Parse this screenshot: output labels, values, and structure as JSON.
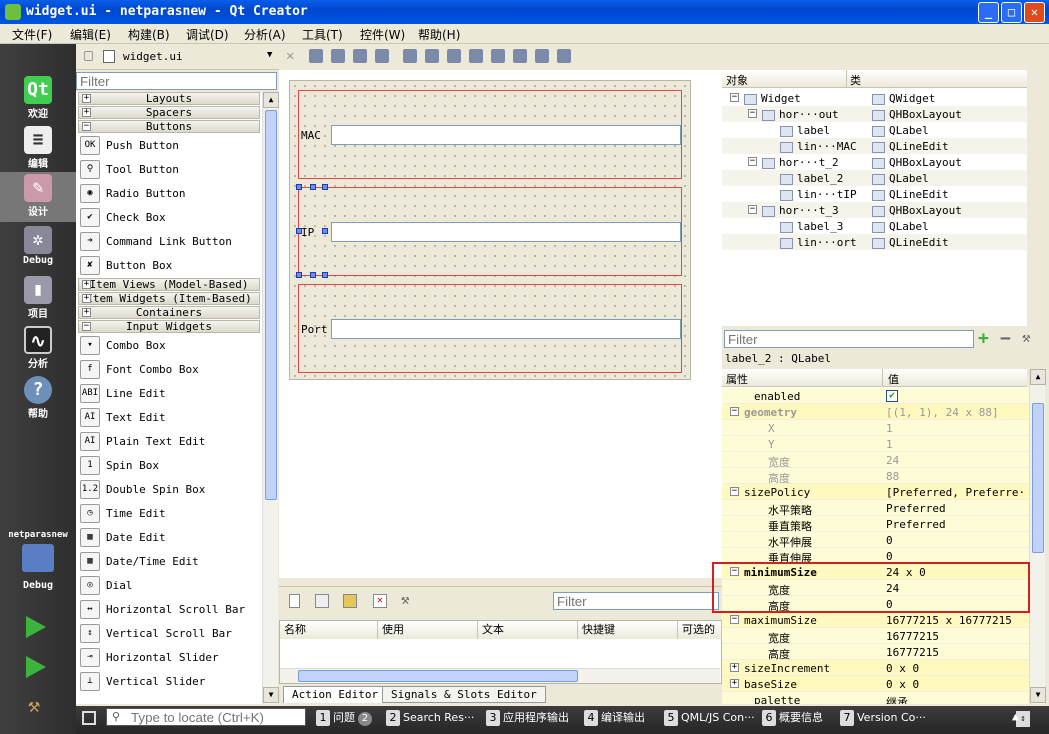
{
  "window": {
    "title": "widget.ui - netparasnew - Qt Creator"
  },
  "menu": [
    "文件(F)",
    "编辑(E)",
    "构建(B)",
    "调试(D)",
    "分析(A)",
    "工具(T)",
    "控件(W)",
    "帮助(H)"
  ],
  "modes": [
    {
      "label": "欢迎",
      "icon": "qt-logo-icon"
    },
    {
      "label": "编辑",
      "icon": "document-icon"
    },
    {
      "label": "设计",
      "icon": "design-pen-icon"
    },
    {
      "label": "Debug",
      "icon": "debug-bug-icon"
    },
    {
      "label": "项目",
      "icon": "project-wrench-icon"
    },
    {
      "label": "分析",
      "icon": "analyze-monitor-icon"
    },
    {
      "label": "帮助",
      "icon": "help-question-icon"
    }
  ],
  "kit": {
    "project": "netparasnew",
    "config": "Debug"
  },
  "doc": {
    "filename": "widget.ui"
  },
  "widget_box": {
    "filter_placeholder": "Filter",
    "items": [
      {
        "kind": "cat",
        "label": "Layouts",
        "sign": "+"
      },
      {
        "kind": "cat",
        "label": "Spacers",
        "sign": "+"
      },
      {
        "kind": "cat",
        "label": "Buttons",
        "sign": "−"
      },
      {
        "kind": "w",
        "label": "Push Button",
        "icon": "OK"
      },
      {
        "kind": "w",
        "label": "Tool Button",
        "icon": "⚲"
      },
      {
        "kind": "w",
        "label": "Radio Button",
        "icon": "◉"
      },
      {
        "kind": "w",
        "label": "Check Box",
        "icon": "✔"
      },
      {
        "kind": "w",
        "label": "Command Link Button",
        "icon": "➜"
      },
      {
        "kind": "w",
        "label": "Button Box",
        "icon": "✘"
      },
      {
        "kind": "cat",
        "label": "Item Views (Model-Based)",
        "sign": "+"
      },
      {
        "kind": "cat",
        "label": "Item Widgets (Item-Based)",
        "sign": "+"
      },
      {
        "kind": "cat",
        "label": "Containers",
        "sign": "+"
      },
      {
        "kind": "cat",
        "label": "Input Widgets",
        "sign": "−"
      },
      {
        "kind": "w",
        "label": "Combo Box",
        "icon": "▾"
      },
      {
        "kind": "w",
        "label": "Font Combo Box",
        "icon": "f"
      },
      {
        "kind": "w",
        "label": "Line Edit",
        "icon": "ABI"
      },
      {
        "kind": "w",
        "label": "Text Edit",
        "icon": "AI"
      },
      {
        "kind": "w",
        "label": "Plain Text Edit",
        "icon": "AI"
      },
      {
        "kind": "w",
        "label": "Spin Box",
        "icon": "1"
      },
      {
        "kind": "w",
        "label": "Double Spin Box",
        "icon": "1.2"
      },
      {
        "kind": "w",
        "label": "Time Edit",
        "icon": "◷"
      },
      {
        "kind": "w",
        "label": "Date Edit",
        "icon": "▦"
      },
      {
        "kind": "w",
        "label": "Date/Time Edit",
        "icon": "▦"
      },
      {
        "kind": "w",
        "label": "Dial",
        "icon": "◎"
      },
      {
        "kind": "w",
        "label": "Horizontal Scroll Bar",
        "icon": "↔"
      },
      {
        "kind": "w",
        "label": "Vertical Scroll Bar",
        "icon": "↕"
      },
      {
        "kind": "w",
        "label": "Horizontal Slider",
        "icon": "⊸"
      },
      {
        "kind": "w",
        "label": "Vertical Slider",
        "icon": "⊥"
      }
    ]
  },
  "form": {
    "rows": [
      {
        "label": "MAC"
      },
      {
        "label": "IP"
      },
      {
        "label": "Port"
      }
    ]
  },
  "action_editor": {
    "filter_placeholder": "Filter",
    "columns": [
      "名称",
      "使用",
      "文本",
      "快捷键",
      "可选的"
    ],
    "tabs": [
      "Action Editor",
      "Signals & Slots Editor"
    ]
  },
  "object_inspector": {
    "columns": [
      "对象",
      "类"
    ],
    "rows": [
      {
        "name": "Widget",
        "cls": "QWidget",
        "indent": 0,
        "sign": "−"
      },
      {
        "name": "hor···out",
        "cls": "QHBoxLayout",
        "indent": 1,
        "sign": "−"
      },
      {
        "name": "label",
        "cls": "QLabel",
        "indent": 2,
        "sign": ""
      },
      {
        "name": "lin···MAC",
        "cls": "QLineEdit",
        "indent": 2,
        "sign": ""
      },
      {
        "name": "hor···t_2",
        "cls": "QHBoxLayout",
        "indent": 1,
        "sign": "−"
      },
      {
        "name": "label_2",
        "cls": "QLabel",
        "indent": 2,
        "sign": ""
      },
      {
        "name": "lin···tIP",
        "cls": "QLineEdit",
        "indent": 2,
        "sign": ""
      },
      {
        "name": "hor···t_3",
        "cls": "QHBoxLayout",
        "indent": 1,
        "sign": "−"
      },
      {
        "name": "label_3",
        "cls": "QLabel",
        "indent": 2,
        "sign": ""
      },
      {
        "name": "lin···ort",
        "cls": "QLineEdit",
        "indent": 2,
        "sign": ""
      }
    ]
  },
  "property_editor": {
    "filter_placeholder": "Filter",
    "class_label": "label_2 : QLabel",
    "columns": [
      "属性",
      "值"
    ],
    "rows": [
      {
        "name": "enabled",
        "value": "✔",
        "indent": 1,
        "bg": "y1",
        "bold": false,
        "dis": false,
        "check": true
      },
      {
        "name": "geometry",
        "value": "[(1, 1), 24 x 88]",
        "indent": 0,
        "bg": "y2",
        "bold": true,
        "dis": true,
        "sign": "−",
        "namecolor": "#999"
      },
      {
        "name": "X",
        "value": "1",
        "indent": 2,
        "bg": "y1",
        "dis": true
      },
      {
        "name": "Y",
        "value": "1",
        "indent": 2,
        "bg": "y1",
        "dis": true
      },
      {
        "name": "宽度",
        "value": "24",
        "indent": 2,
        "bg": "y1",
        "dis": true
      },
      {
        "name": "高度",
        "value": "88",
        "indent": 2,
        "bg": "y1",
        "dis": true
      },
      {
        "name": "sizePolicy",
        "value": "[Preferred, Preferre···",
        "indent": 0,
        "bg": "y2",
        "sign": "−"
      },
      {
        "name": "水平策略",
        "value": "Preferred",
        "indent": 2,
        "bg": "y1"
      },
      {
        "name": "垂直策略",
        "value": "Preferred",
        "indent": 2,
        "bg": "y1"
      },
      {
        "name": "水平伸展",
        "value": "0",
        "indent": 2,
        "bg": "y1"
      },
      {
        "name": "垂直伸展",
        "value": "0",
        "indent": 2,
        "bg": "y1"
      },
      {
        "name": "minimumSize",
        "value": "24 x 0",
        "indent": 0,
        "bg": "y2",
        "bold": true,
        "sign": "−"
      },
      {
        "name": "宽度",
        "value": "24",
        "indent": 2,
        "bg": "y1"
      },
      {
        "name": "高度",
        "value": "0",
        "indent": 2,
        "bg": "y1"
      },
      {
        "name": "maximumSize",
        "value": "16777215 x 16777215",
        "indent": 0,
        "bg": "y2",
        "sign": "−"
      },
      {
        "name": "宽度",
        "value": "16777215",
        "indent": 2,
        "bg": "y1"
      },
      {
        "name": "高度",
        "value": "16777215",
        "indent": 2,
        "bg": "y1"
      },
      {
        "name": "sizeIncrement",
        "value": "0 x 0",
        "indent": 0,
        "bg": "y2",
        "sign": "+"
      },
      {
        "name": "baseSize",
        "value": "0 x 0",
        "indent": 0,
        "bg": "y2",
        "sign": "+"
      },
      {
        "name": "palette",
        "value": "继承",
        "indent": 1,
        "bg": "y1"
      }
    ]
  },
  "statusbar": {
    "locate_placeholder": "Type to locate (Ctrl+K)",
    "panes": [
      {
        "num": "1",
        "label": "问题",
        "badge": "2"
      },
      {
        "num": "2",
        "label": "Search Res···"
      },
      {
        "num": "3",
        "label": "应用程序输出"
      },
      {
        "num": "4",
        "label": "编译输出"
      },
      {
        "num": "5",
        "label": "QML/JS Con···"
      },
      {
        "num": "6",
        "label": "概要信息"
      },
      {
        "num": "7",
        "label": "Version Co···"
      }
    ]
  }
}
